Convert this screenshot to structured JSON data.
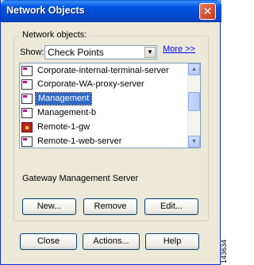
{
  "window": {
    "title": "Network Objects",
    "close_glyph": "✕"
  },
  "group": {
    "label": "Network objects:"
  },
  "filter": {
    "show_label": "Show:",
    "selected": "Check Points",
    "more_link": "More >>"
  },
  "list": {
    "items": [
      {
        "label": "Corporate-internal-terminal-server",
        "icon": "host-icon",
        "selected": false
      },
      {
        "label": "Corporate-WA-proxy-server",
        "icon": "host-icon",
        "selected": false
      },
      {
        "label": "Management",
        "icon": "checkpoint-icon",
        "selected": true
      },
      {
        "label": "Management-b",
        "icon": "checkpoint-icon",
        "selected": false
      },
      {
        "label": "Remote-1-gw",
        "icon": "gateway-icon",
        "selected": false
      },
      {
        "label": "Remote-1-web-server",
        "icon": "host-icon",
        "selected": false
      }
    ]
  },
  "description": "Gateway Management Server",
  "buttons": {
    "new": "New...",
    "remove": "Remove",
    "edit": "Edit...",
    "close": "Close",
    "actions": "Actions...",
    "help": "Help"
  },
  "figure_number": "143634",
  "colors": {
    "titlebar": "#0054e3",
    "selection": "#316ac5",
    "link": "#0000ff"
  }
}
